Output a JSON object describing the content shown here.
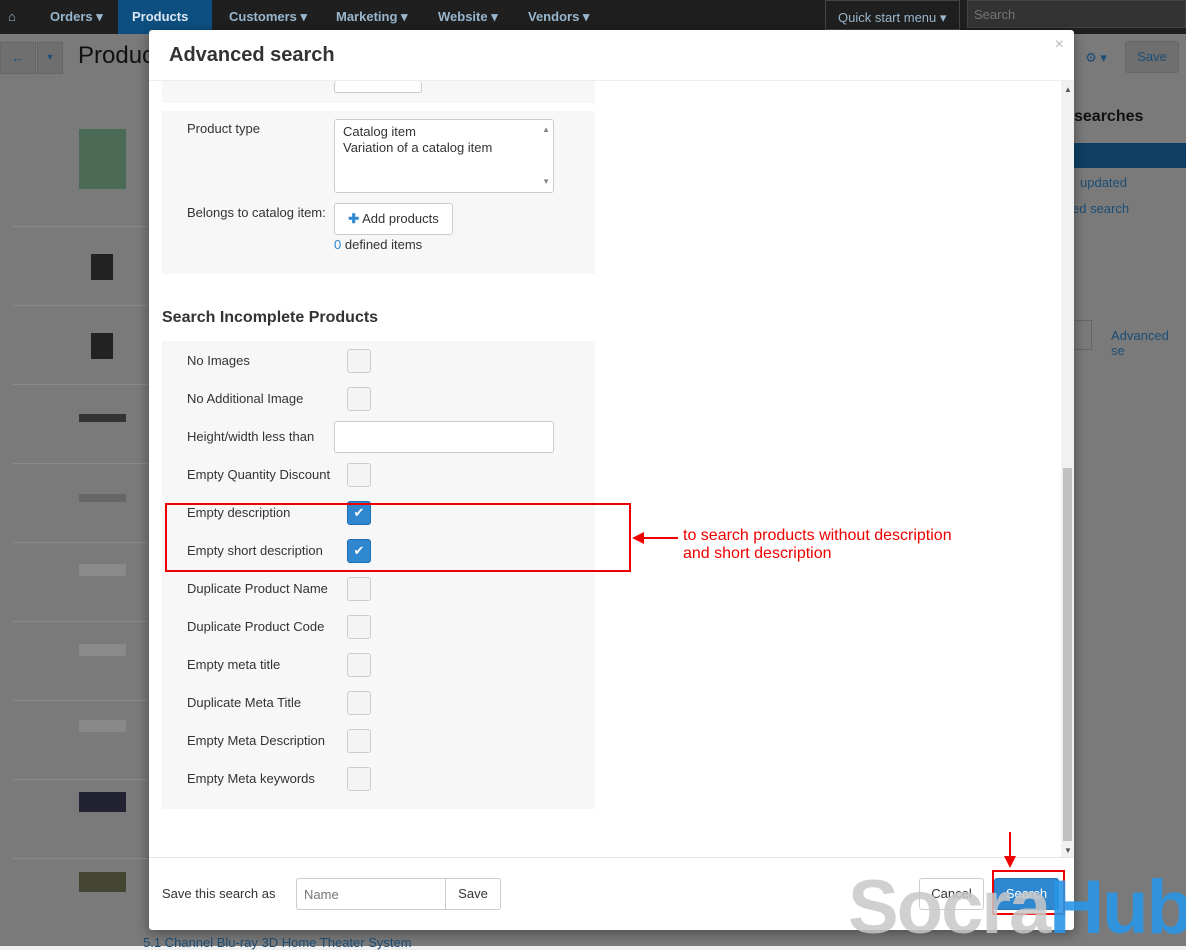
{
  "nav": {
    "items": [
      "Orders",
      "Products",
      "Customers",
      "Marketing",
      "Website",
      "Vendors"
    ],
    "quick_start": "Quick start menu",
    "search_placeholder": "Search"
  },
  "page": {
    "title": "Produc",
    "save": "Save",
    "saved_searches": "searches",
    "links": [
      "updated",
      "ed search"
    ],
    "advanced": "Advanced se",
    "last_product": "5.1 Channel Blu-ray 3D Home Theater System"
  },
  "modal": {
    "title": "Advanced search",
    "close": "×",
    "product_type": {
      "label": "Product type",
      "options": [
        "Catalog item",
        "Variation of a catalog item"
      ]
    },
    "belongs": {
      "label": "Belongs to catalog item:",
      "button": "Add products",
      "count": "0",
      "count_suffix": "defined items"
    },
    "section_title": "Search Incomplete Products",
    "fields": [
      {
        "label": "No Images",
        "checked": false
      },
      {
        "label": "No Additional Image",
        "checked": false
      },
      {
        "label": "Height/width less than",
        "type": "text"
      },
      {
        "label": "Empty Quantity Discount",
        "checked": false
      },
      {
        "label": "Empty description",
        "checked": true
      },
      {
        "label": "Empty short description",
        "checked": true
      },
      {
        "label": "Duplicate Product Name",
        "checked": false
      },
      {
        "label": "Duplicate Product Code",
        "checked": false
      },
      {
        "label": "Empty meta title",
        "checked": false
      },
      {
        "label": "Duplicate Meta Title",
        "checked": false
      },
      {
        "label": "Empty Meta Description",
        "checked": false
      },
      {
        "label": "Empty Meta keywords",
        "checked": false
      }
    ],
    "annotation": [
      "to search products without description",
      "and short description"
    ],
    "footer": {
      "save_as": "Save this search as",
      "name_placeholder": "Name",
      "save": "Save",
      "cancel": "Cancel",
      "search": "Search"
    }
  },
  "watermark": {
    "part1": "Socra",
    "part2": "Hub"
  }
}
